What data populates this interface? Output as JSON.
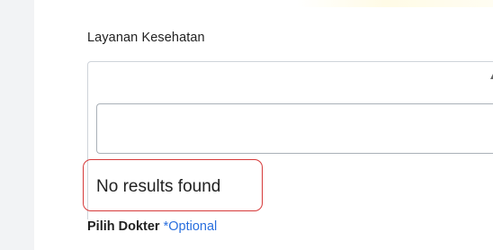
{
  "form": {
    "service_label": "Layanan Kesehatan",
    "service_select": {
      "selected_value": "",
      "caret_icon": "chevron-up-icon",
      "search_value": "",
      "empty_message": "No results found"
    },
    "doctor_label": "Pilih Dokter",
    "doctor_optional_tag": "*Optional"
  },
  "colors": {
    "highlight": "#d63a3a",
    "optional_tag": "#2a6fde",
    "sidebar_bg": "#f2f3f5"
  }
}
